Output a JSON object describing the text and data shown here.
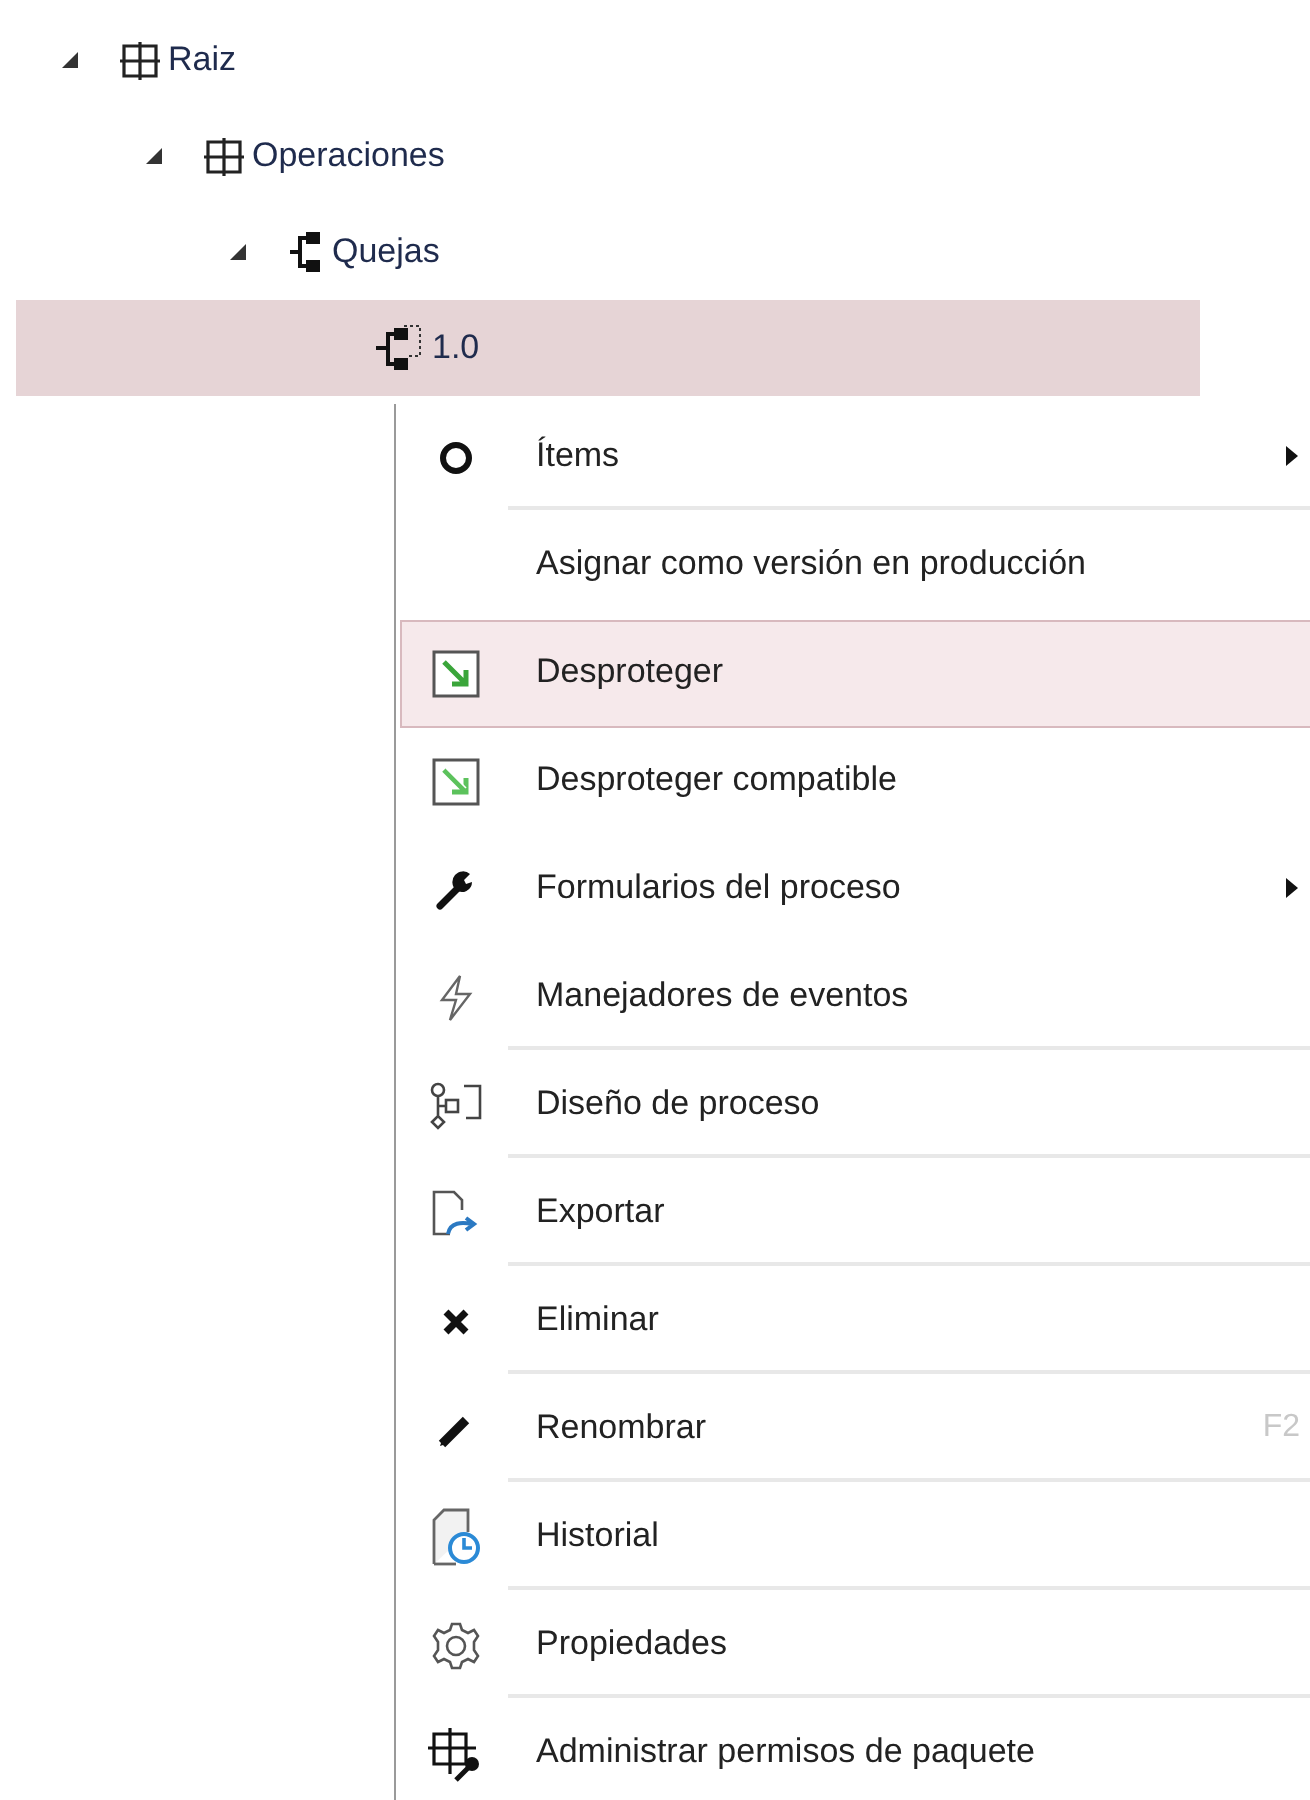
{
  "tree": [
    {
      "label": "Raiz",
      "kind": "package",
      "expanded": true,
      "selected": false,
      "children": [
        {
          "label": "Operaciones",
          "kind": "package",
          "expanded": true,
          "selected": false,
          "children": [
            {
              "label": "Quejas",
              "kind": "process",
              "expanded": true,
              "selected": false,
              "children": [
                {
                  "label": "1.0",
                  "kind": "version",
                  "selected": true
                }
              ]
            }
          ]
        }
      ]
    }
  ],
  "context_menu": {
    "items": [
      {
        "label": "Ítems",
        "submenu": true,
        "selected": false,
        "divider_after": true
      },
      {
        "label": "Asignar como versión en producción",
        "selected": false,
        "divider_after": false
      },
      {
        "label": "Desproteger",
        "selected": true,
        "divider_after": false
      },
      {
        "label": "Desproteger compatible",
        "selected": false,
        "divider_after": false
      },
      {
        "label": "Formularios del proceso",
        "submenu": true,
        "selected": false,
        "divider_after": false
      },
      {
        "label": "Manejadores de eventos",
        "selected": false,
        "divider_after": true
      },
      {
        "label": "Diseño de proceso",
        "selected": false,
        "divider_after": true
      },
      {
        "label": "Exportar",
        "selected": false,
        "divider_after": true
      },
      {
        "label": "Eliminar",
        "selected": false,
        "divider_after": true
      },
      {
        "label": "Renombrar",
        "shortcut": "F2",
        "selected": false,
        "divider_after": true
      },
      {
        "label": "Historial",
        "selected": false,
        "divider_after": true
      },
      {
        "label": "Propiedades",
        "selected": false,
        "divider_after": true
      },
      {
        "label": "Administrar permisos de paquete",
        "selected": false
      }
    ]
  }
}
